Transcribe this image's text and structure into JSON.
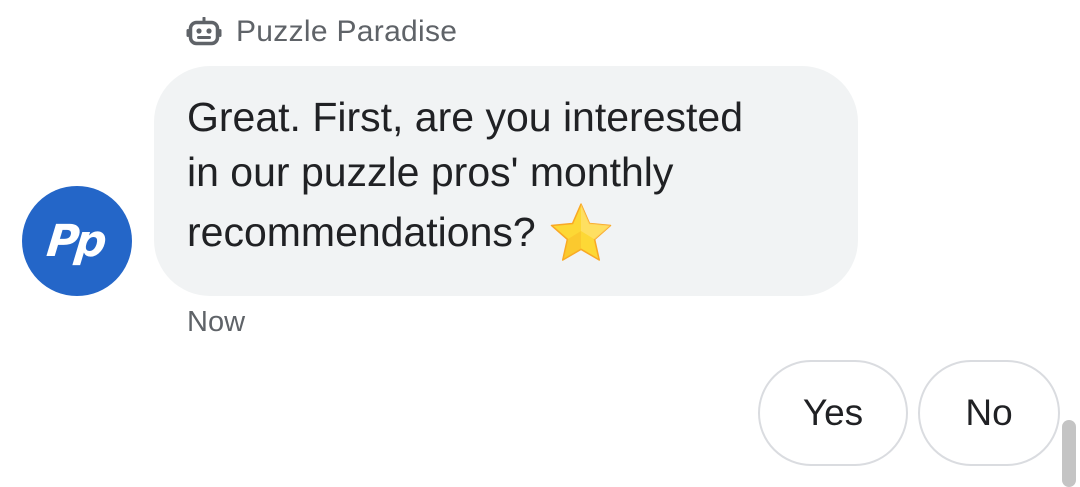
{
  "sender": {
    "icon": "bot-icon",
    "name": "Puzzle Paradise"
  },
  "avatar": {
    "initials": "Pp",
    "color": "#2466c8"
  },
  "message": {
    "text": "Great. First, are you interested\nin our puzzle pros' monthly\nrecommendations?",
    "emoji_icon": "star-icon",
    "bubble_color": "#f1f3f4",
    "timestamp": "Now"
  },
  "suggestions": [
    {
      "label": "Yes"
    },
    {
      "label": "No"
    }
  ]
}
